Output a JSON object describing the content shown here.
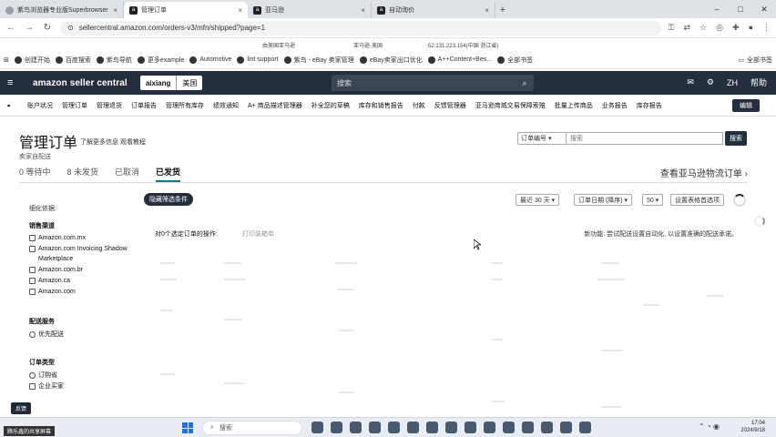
{
  "browser": {
    "tabs": [
      {
        "label": "紫鸟浏览器专业版Superbrowser",
        "active": false,
        "icon": "browser-icon"
      },
      {
        "label": "管理订单",
        "active": true,
        "icon": "amazon-icon"
      },
      {
        "label": "亚马逊",
        "active": false,
        "icon": "amazon-icon"
      },
      {
        "label": "自动询价",
        "active": false,
        "icon": "amazon-icon"
      }
    ],
    "new_tab": "+",
    "url": "sellercentral.amazon.com/orders-v3/mfn/shipped?page=1",
    "info_row": [
      "由美国亚马逊",
      "亚马逊·美国",
      "52.131.223.154(中国 浙江省)"
    ],
    "bookmarks": [
      "创建开始",
      "百度搜索",
      "紫鸟导航",
      "更多example",
      "Automotive",
      "lint support",
      "紫鸟 - eBay 卖家管理",
      "eBay卖家出口优化",
      "A++Content+Bes...",
      "全部书签"
    ],
    "bookmarks_right": "全部书签"
  },
  "seller_header": {
    "logo": "amazon seller central",
    "account": "aixiang",
    "marketplace": "美国",
    "search_placeholder": "搜索",
    "lang": "ZH",
    "help": "帮助"
  },
  "nav": {
    "items": [
      "账户状况",
      "管理订单",
      "管理退货",
      "订单报告",
      "管理所有库存",
      "绩效通知",
      "A+ 商品描述管理器",
      "补全您的草稿",
      "库存和销售报告",
      "付款",
      "反馈管理器",
      "亚马逊商城交易保障索赔",
      "批量上传商品",
      "业务报告",
      "库存报告"
    ],
    "edit": "编辑"
  },
  "page": {
    "title": "管理订单",
    "title_links": "了解更多信息  观看教程",
    "subnote": "卖家自配送",
    "order_select": "订单编号",
    "search_placeholder": "搜索",
    "search_button": "搜索",
    "tabs": [
      "0 等待中",
      "8 未发货",
      "已取消",
      "已发货"
    ],
    "global_link": "查看亚马逊物流订单 ›"
  },
  "filters": {
    "title": "细化依据:",
    "sales_channel": {
      "head": "销售渠道",
      "options": [
        "Amazon.com.mx",
        "Amazon.com Invoicing Shadow Marketplace",
        "Amazon.com.br",
        "Amazon.ca",
        "Amazon.com"
      ]
    },
    "fulfillment": {
      "head": "配送服务",
      "options": [
        "优先配送"
      ]
    },
    "order_type": {
      "head": "订单类型",
      "options": [
        "订购省",
        "企业买家"
      ]
    }
  },
  "toolbar": {
    "hide_filters": "隐藏筛选条件",
    "date_range": "最近 30 天 ▾",
    "sort": "订单日期 (降序) ▾",
    "per_page": "50 ▾",
    "settings": "设置表格首选项",
    "bulk_action": "对0个选定订单的操作:",
    "print_slip": "打印装箱单",
    "promo": "新功能: 尝试配送设置自动化, 以设置准确的配送承诺。"
  },
  "overlays": {
    "feedback": "反馈",
    "share": "腾乐鑫的共享屏幕"
  },
  "taskbar": {
    "search": "搜索",
    "time": "17:04",
    "date": "2024/9/18"
  }
}
